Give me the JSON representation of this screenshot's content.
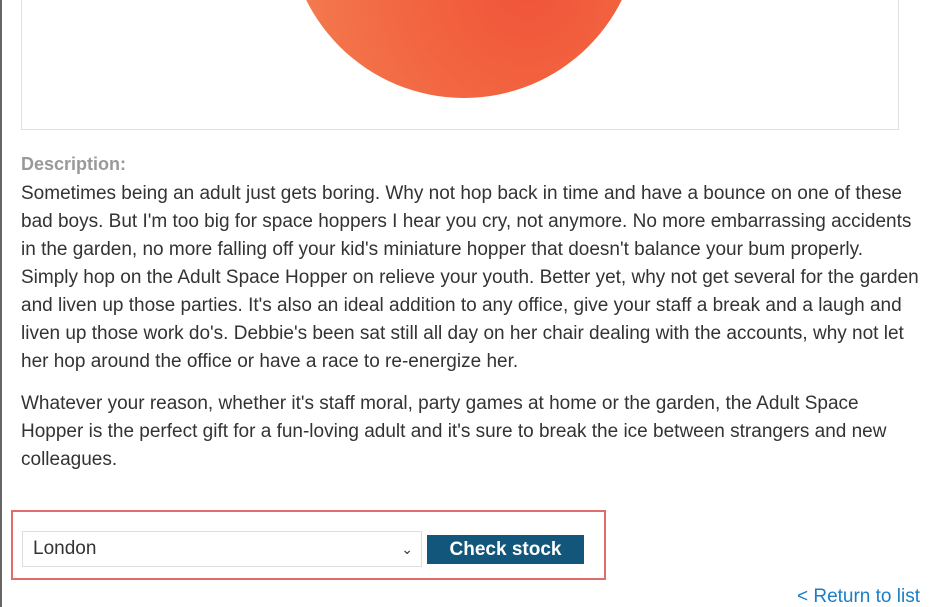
{
  "product": {
    "image_alt": "Adult Space Hopper ball"
  },
  "description": {
    "heading": "Description:",
    "paragraphs": [
      "Sometimes being an adult just gets boring. Why not hop back in time and have a bounce on one of these bad boys. But I'm too big for space hoppers I hear you cry, not anymore. No more embarrassing accidents in the garden, no more falling off your kid's miniature hopper that doesn't balance your bum properly. Simply hop on the Adult Space Hopper on relieve your youth. Better yet, why not get several for the garden and liven up those parties. It's also an ideal addition to any office, give your staff a break and a laugh and liven up those work do's. Debbie's been sat still all day on her chair dealing with the accounts, why not let her hop around the office or have a race to re-energize her.",
      "Whatever your reason, whether it's staff moral, party games at home or the garden, the Adult Space Hopper is the perfect gift for a fun-loving adult and it's sure to break the ice between strangers and new colleagues."
    ]
  },
  "stock_form": {
    "selected_store": "London",
    "check_button_label": "Check stock",
    "highlight_color": "#e06c6c",
    "button_color": "#13567b"
  },
  "navigation": {
    "return_link_label": "< Return to list",
    "link_color": "#1a7ec7"
  },
  "icons": {
    "select_chevron": "chevron-down-icon"
  }
}
